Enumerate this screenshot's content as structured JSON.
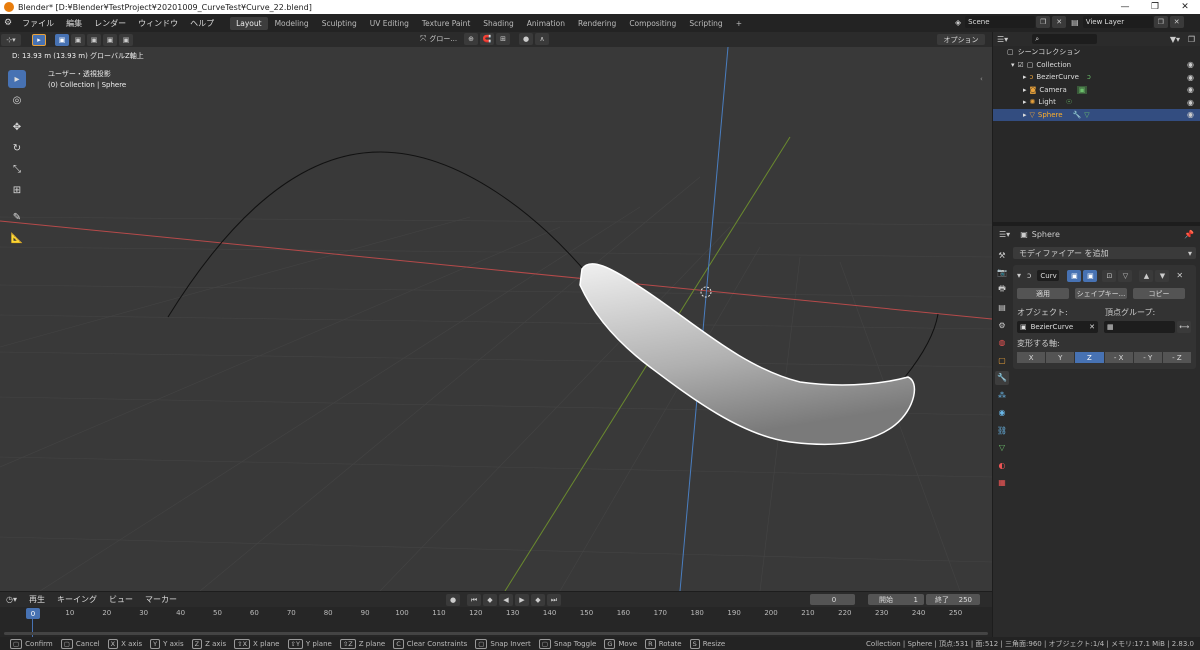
{
  "window": {
    "title": "Blender* [D:¥Blender¥TestProject¥20201009_CurveTest¥Curve_22.blend]",
    "minimize": "—",
    "maximize": "❐",
    "close": "✕"
  },
  "menu": {
    "items": [
      "ファイル",
      "編集",
      "レンダー",
      "ウィンドウ",
      "ヘルプ"
    ]
  },
  "workspaces": [
    "Layout",
    "Modeling",
    "Sculpting",
    "UV Editing",
    "Texture Paint",
    "Shading",
    "Animation",
    "Rendering",
    "Compositing",
    "Scripting",
    "+"
  ],
  "scene": {
    "label": "Scene",
    "view_layer": "View Layer"
  },
  "viewport": {
    "transform_orientation": "グロー...",
    "options_label": "オプション",
    "operation_info": "D: 13.93 m (13.93 m) グローバルZ軸上",
    "view_name": "ユーザー・透視投影",
    "collection_info": "(0) Collection | Sphere"
  },
  "outliner": {
    "search_placeholder": "",
    "root": "シーンコレクション",
    "collection": "Collection",
    "items": [
      "BezierCurve",
      "Camera",
      "Light",
      "Sphere"
    ]
  },
  "properties": {
    "object_name": "Sphere",
    "add_modifier": "モディファイアー を追加",
    "modifier_name": "Curv",
    "apply": "適用",
    "shapekey": "シェイプキー...",
    "copy": "コピー",
    "object_label": "オブジェクト:",
    "object_value": "BezierCurve",
    "vgroup_label": "頂点グループ:",
    "deform_axis_label": "変形する軸:",
    "axes": [
      "X",
      "Y",
      "Z",
      "- X",
      "- Y",
      "- Z"
    ],
    "active_axis": "Z"
  },
  "timeline": {
    "menus": [
      "再生",
      "キーイング",
      "ビュー",
      "マーカー"
    ],
    "current_frame": "0",
    "start_label": "開始",
    "start": "1",
    "end_label": "終了",
    "end": "250",
    "ticks": [
      "0",
      "10",
      "20",
      "30",
      "40",
      "50",
      "60",
      "70",
      "80",
      "90",
      "100",
      "110",
      "120",
      "130",
      "140",
      "150",
      "160",
      "170",
      "180",
      "190",
      "200",
      "210",
      "220",
      "230",
      "240",
      "250"
    ]
  },
  "status": {
    "hints": [
      {
        "key": "",
        "label": "Confirm"
      },
      {
        "key": "",
        "label": "Cancel"
      },
      {
        "key": "X",
        "label": "X axis"
      },
      {
        "key": "Y",
        "label": "Y axis"
      },
      {
        "key": "Z",
        "label": "Z axis"
      },
      {
        "key": "⇧X",
        "label": "X plane"
      },
      {
        "key": "⇧Y",
        "label": "Y plane"
      },
      {
        "key": "⇧Z",
        "label": "Z plane"
      },
      {
        "key": "C",
        "label": "Clear Constraints"
      },
      {
        "key": "",
        "label": "Snap Invert"
      },
      {
        "key": "",
        "label": "Snap Toggle"
      },
      {
        "key": "G",
        "label": "Move"
      },
      {
        "key": "R",
        "label": "Rotate"
      },
      {
        "key": "S",
        "label": "Resize"
      }
    ],
    "stats": "Collection | Sphere | 頂点:531 | 面:512 | 三角面:960 | オブジェクト:1/4 | メモリ:17.1 MiB | 2.83.0"
  },
  "colors": {
    "accent": "#4772b3",
    "selected_row": "#334d80",
    "x_axis": "#b64a4a",
    "y_axis": "#6a8a2e",
    "z_axis": "#4a7ec0"
  }
}
